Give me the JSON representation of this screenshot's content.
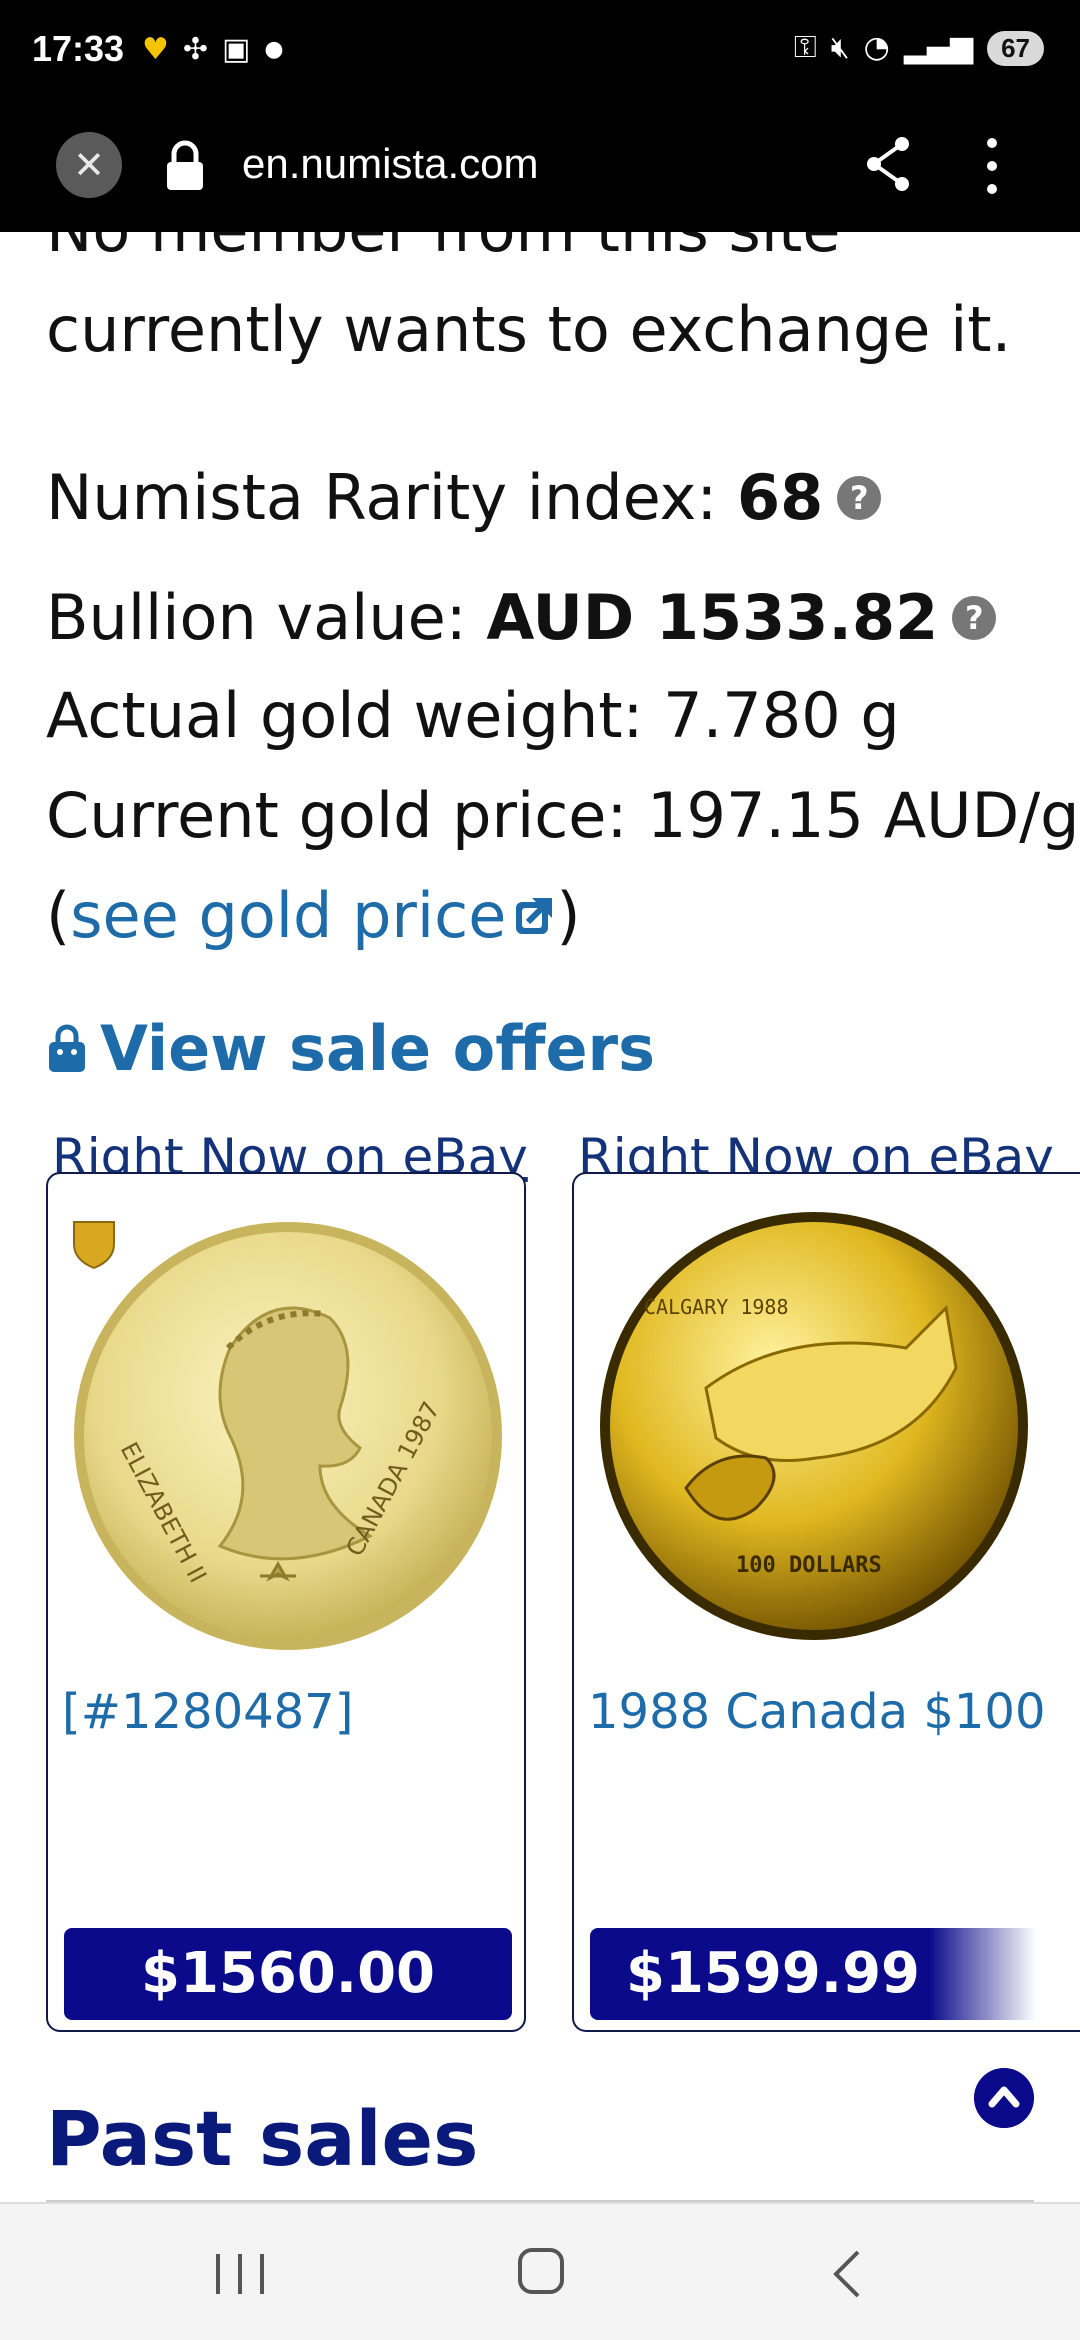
{
  "status_bar": {
    "time": "17:33",
    "notification_icons": [
      "heart-icon",
      "fan-icon",
      "box-icon",
      "dot-icon"
    ],
    "battery": "67"
  },
  "browser": {
    "url": "en.numista.com"
  },
  "content": {
    "cut_text": "No member from this site",
    "exchange_text": "currently wants to exchange it.",
    "rarity_label": "Numista Rarity index: ",
    "rarity_value": "68",
    "bullion_label": "Bullion value: ",
    "bullion_value": "AUD 1533.82",
    "gold_weight": "Actual gold weight: 7.780 g",
    "gold_price": "Current gold price: 197.15 AUD/g",
    "gold_link_open": "(",
    "gold_link": "see gold price",
    "gold_link_close": ")",
    "sale_offers_title": "View sale offers",
    "listings": [
      {
        "source": "Right Now on eBay",
        "title": "[#1280487]",
        "price": "$1560.00",
        "coin_text_left": "ELIZABETH II",
        "coin_text_right": "CANADA 1987"
      },
      {
        "source": "Right Now on eBay",
        "title": "1988 Canada $100",
        "price": "$1599.99",
        "coin_text_top": "CALGARY 1988",
        "coin_text_bottom": "100 DOLLARS"
      }
    ],
    "past_sales_title": "Past sales"
  },
  "colors": {
    "link": "#1d6ba8",
    "price_button": "#0a0a8a",
    "heading": "#0a1a7a"
  }
}
